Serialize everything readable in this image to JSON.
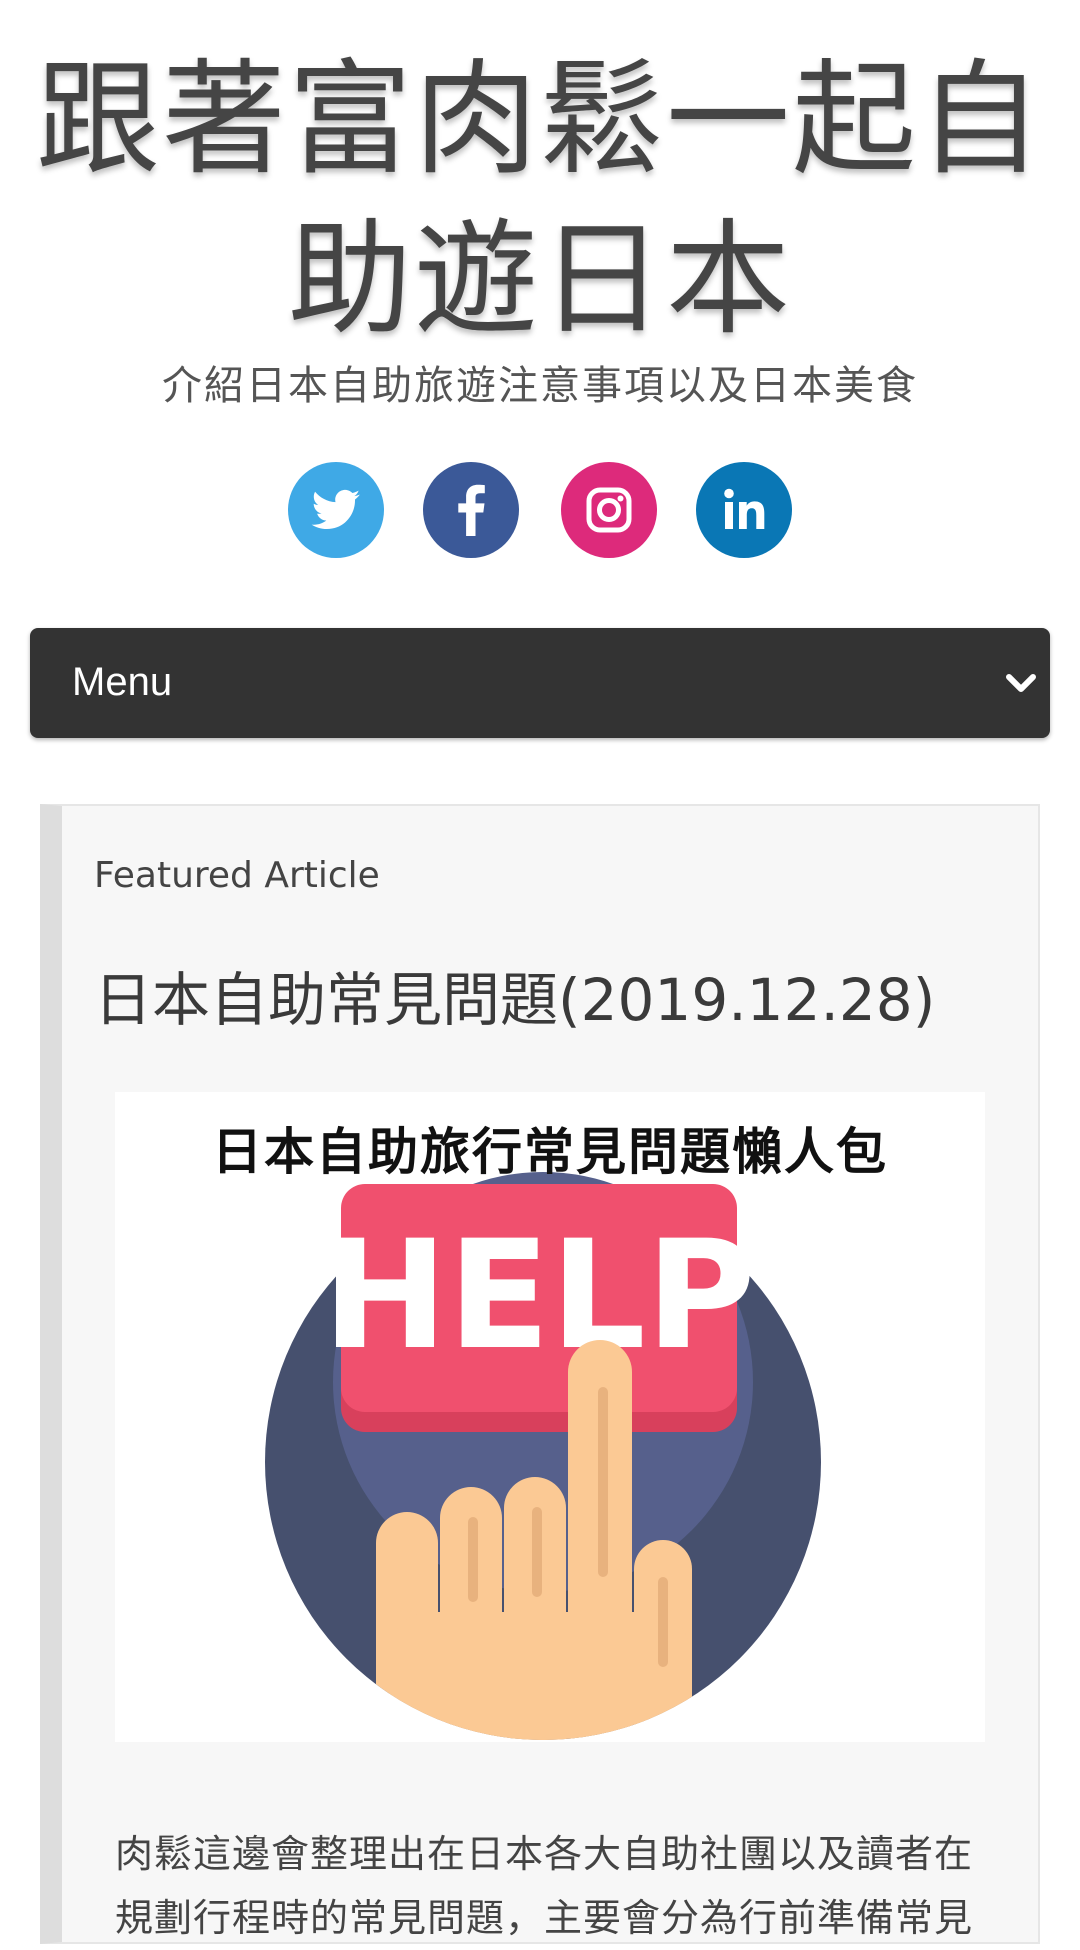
{
  "site": {
    "title": "跟著富肉鬆一起自助遊日本",
    "tagline": "介紹日本自助旅遊注意事項以及日本美食"
  },
  "social": [
    {
      "name": "twitter",
      "icon": "twitter-icon",
      "color": "#3fa9e6"
    },
    {
      "name": "facebook",
      "icon": "facebook-icon",
      "color": "#3b5998"
    },
    {
      "name": "instagram",
      "icon": "instagram-icon",
      "color": "#dd2a7b"
    },
    {
      "name": "linkedin",
      "icon": "linkedin-icon",
      "color": "#0a77b5"
    }
  ],
  "menu": {
    "label": "Menu",
    "icon": "chevron-down-icon",
    "background": "#333333"
  },
  "featured": {
    "label": "Featured Article",
    "title": "日本自助常見問題(2019.12.28)",
    "image": {
      "caption": "日本自助旅行常見問題懶人包",
      "button_text": "HELP",
      "colors": {
        "circle_outer": "#46506e",
        "circle_inner": "#56608c",
        "button": "#f0506e",
        "button_shadow": "#d8405c",
        "hand": "#fbc994"
      }
    },
    "excerpt": "肉鬆這邊會整理出在日本各大自助社團以及讀者在規劃行程時的常見問題，主要會分為行前準備常見"
  }
}
